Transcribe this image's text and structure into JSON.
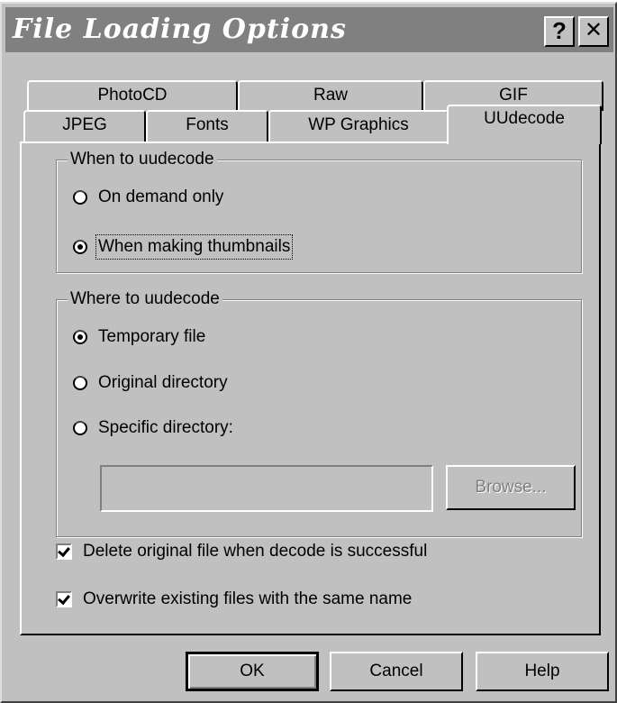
{
  "window": {
    "title": "File Loading Options",
    "help_glyph": "?",
    "close_glyph": "✕"
  },
  "tabs_back": [
    "PhotoCD",
    "Raw",
    "GIF"
  ],
  "tabs_front": [
    "JPEG",
    "Fonts",
    "WP Graphics",
    "UUdecode"
  ],
  "active_tab": "UUdecode",
  "when_group": {
    "legend": "When to uudecode",
    "options": [
      "On demand only",
      "When making thumbnails"
    ],
    "selected": "When making thumbnails"
  },
  "where_group": {
    "legend": "Where to uudecode",
    "options": [
      "Temporary file",
      "Original directory",
      "Specific directory:"
    ],
    "selected": "Temporary file",
    "directory_value": "",
    "browse_label": "Browse..."
  },
  "checkboxes": [
    {
      "label": "Delete original file when decode is successful",
      "checked": true
    },
    {
      "label": "Overwrite existing files with the same name",
      "checked": true
    }
  ],
  "buttons": {
    "ok": "OK",
    "cancel": "Cancel",
    "help": "Help"
  }
}
